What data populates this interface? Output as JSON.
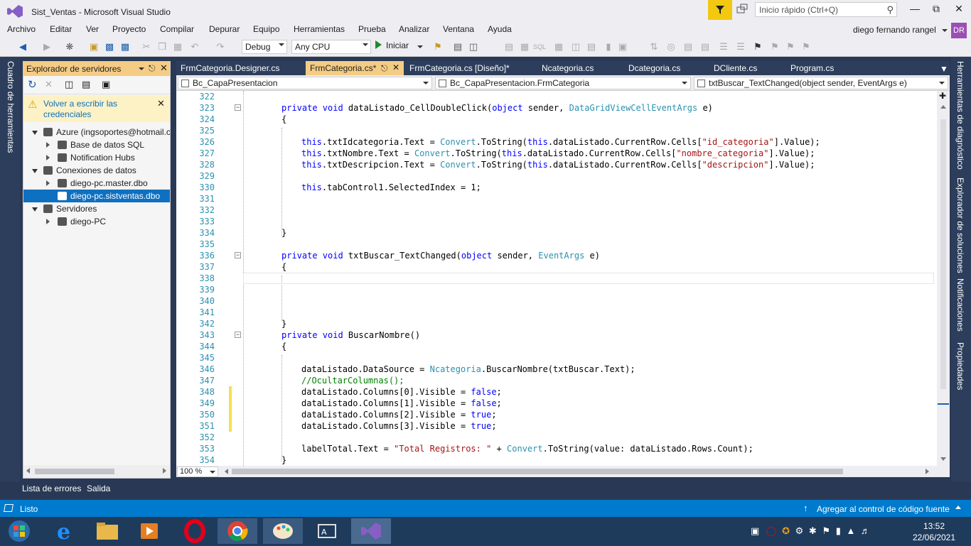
{
  "window": {
    "title": "Sist_Ventas - Microsoft Visual Studio"
  },
  "quick_launch": {
    "placeholder": "Inicio rápido (Ctrl+Q)"
  },
  "menu": [
    "Archivo",
    "Editar",
    "Ver",
    "Proyecto",
    "Compilar",
    "Depurar",
    "Equipo",
    "Herramientas",
    "Prueba",
    "Analizar",
    "Ventana",
    "Ayuda"
  ],
  "user": {
    "name": "diego fernando rangel",
    "initials": "DR"
  },
  "toolbar": {
    "config": "Debug",
    "platform": "Any CPU",
    "start_label": "Iniciar"
  },
  "left_strip": {
    "label": "Cuadro de herramientas"
  },
  "right_strip": [
    "Herramientas de diagnóstico",
    "Explorador de soluciones",
    "Notificaciones",
    "Propiedades"
  ],
  "server_explorer": {
    "title": "Explorador de servidores",
    "warning": "Volver a escribir las credenciales",
    "tree": [
      {
        "label": "Azure (ingsoportes@hotmail.c",
        "indent": 0,
        "exp": "open"
      },
      {
        "label": "Base de datos SQL",
        "indent": 1,
        "exp": "closed"
      },
      {
        "label": "Notification Hubs",
        "indent": 1,
        "exp": "closed"
      },
      {
        "label": "Conexiones de datos",
        "indent": 0,
        "exp": "open"
      },
      {
        "label": "diego-pc.master.dbo",
        "indent": 1,
        "exp": "closed"
      },
      {
        "label": "diego-pc.sistventas.dbo",
        "indent": 1,
        "exp": "none",
        "selected": true
      },
      {
        "label": "Servidores",
        "indent": 0,
        "exp": "open"
      },
      {
        "label": "diego-PC",
        "indent": 1,
        "exp": "closed"
      }
    ]
  },
  "tabs": [
    "FrmCategoria.Designer.cs",
    "FrmCategoria.cs*",
    "FrmCategoria.cs [Diseño]*",
    "Ncategoria.cs",
    "Dcategoria.cs",
    "DCliente.cs",
    "Program.cs"
  ],
  "nav": {
    "project": "Bc_CapaPresentacion",
    "class": "Bc_CapaPresentacion.FrmCategoria",
    "member": "txtBuscar_TextChanged(object sender, EventArgs e)"
  },
  "zoom": "100 %",
  "code_lines": [
    {
      "n": "322",
      "html": ""
    },
    {
      "n": "323",
      "html": "<span class=\"kw\">private void</span> dataListado_CellDoubleClick(<span class=\"kw\">object</span> sender, <span class=\"ty\">DataGridViewCellEventArgs</span> e)",
      "indent": 0,
      "fold": true
    },
    {
      "n": "324",
      "html": "{",
      "indent": 0
    },
    {
      "n": "325",
      "html": ""
    },
    {
      "n": "326",
      "html": "<span class=\"kw\">this</span>.txtIdcategoria.Text = <span class=\"ty\">Convert</span>.ToString(<span class=\"kw\">this</span>.dataListado.CurrentRow.Cells[<span class=\"st\">\"id_categoria\"</span>].Value);",
      "indent": 1
    },
    {
      "n": "327",
      "html": "<span class=\"kw\">this</span>.txtNombre.Text = <span class=\"ty\">Convert</span>.ToString(<span class=\"kw\">this</span>.dataListado.CurrentRow.Cells[<span class=\"st\">\"nombre_categoria\"</span>].Value);",
      "indent": 1
    },
    {
      "n": "328",
      "html": "<span class=\"kw\">this</span>.txtDescripcion.Text = <span class=\"ty\">Convert</span>.ToString(<span class=\"kw\">this</span>.dataListado.CurrentRow.Cells[<span class=\"st\">\"descripcion\"</span>].Value);",
      "indent": 1
    },
    {
      "n": "329",
      "html": ""
    },
    {
      "n": "330",
      "html": "<span class=\"kw\">this</span>.tabControl1.SelectedIndex = 1;",
      "indent": 1
    },
    {
      "n": "331",
      "html": ""
    },
    {
      "n": "332",
      "html": ""
    },
    {
      "n": "333",
      "html": ""
    },
    {
      "n": "334",
      "html": "}",
      "indent": 0
    },
    {
      "n": "335",
      "html": ""
    },
    {
      "n": "336",
      "html": "<span class=\"kw\">private void</span> txtBuscar_TextChanged(<span class=\"kw\">object</span> sender, <span class=\"ty\">EventArgs</span> e)",
      "indent": 0,
      "fold": true
    },
    {
      "n": "337",
      "html": "{",
      "indent": 0
    },
    {
      "n": "338",
      "html": "",
      "current": true
    },
    {
      "n": "339",
      "html": ""
    },
    {
      "n": "340",
      "html": ""
    },
    {
      "n": "341",
      "html": ""
    },
    {
      "n": "342",
      "html": "}",
      "indent": 0
    },
    {
      "n": "343",
      "html": "<span class=\"kw\">private void</span> BuscarNombre()",
      "indent": 0,
      "fold": true
    },
    {
      "n": "344",
      "html": "{",
      "indent": 0
    },
    {
      "n": "345",
      "html": ""
    },
    {
      "n": "346",
      "html": "dataListado.DataSource = <span class=\"ty\">Ncategoria</span>.BuscarNombre(txtBuscar.Text);",
      "indent": 1
    },
    {
      "n": "347",
      "html": "<span class=\"cm\">//OcultarColumnas();</span>",
      "indent": 1
    },
    {
      "n": "348",
      "html": "dataListado.Columns[0].Visible = <span class=\"kw\">false</span>;",
      "indent": 1,
      "changed": true
    },
    {
      "n": "349",
      "html": "dataListado.Columns[1].Visible = <span class=\"kw\">false</span>;",
      "indent": 1,
      "changed": true
    },
    {
      "n": "350",
      "html": "dataListado.Columns[2].Visible = <span class=\"kw\">true</span>;",
      "indent": 1,
      "changed": true
    },
    {
      "n": "351",
      "html": "dataListado.Columns[3].Visible = <span class=\"kw\">true</span>;",
      "indent": 1,
      "changed": true
    },
    {
      "n": "352",
      "html": ""
    },
    {
      "n": "353",
      "html": "labelTotal.Text = <span class=\"st\">\"Total Registros: \"</span> + <span class=\"ty\">Convert</span>.ToString(value: dataListado.Rows.Count);",
      "indent": 1
    },
    {
      "n": "354",
      "html": "}",
      "indent": 0
    }
  ],
  "bottom_tabs": [
    "Lista de errores",
    "Salida"
  ],
  "status": {
    "left": "Listo",
    "right": "Agregar al control de código fuente"
  },
  "clock": {
    "time": "13:52",
    "date": "22/06/2021"
  }
}
